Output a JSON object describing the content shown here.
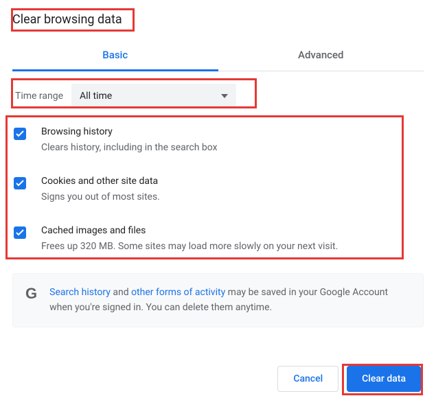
{
  "title": "Clear browsing data",
  "tabs": {
    "basic": "Basic",
    "advanced": "Advanced"
  },
  "time_range": {
    "label": "Time range",
    "value": "All time"
  },
  "options": [
    {
      "title": "Browsing history",
      "desc": "Clears history, including in the search box",
      "checked": true
    },
    {
      "title": "Cookies and other site data",
      "desc": "Signs you out of most sites.",
      "checked": true
    },
    {
      "title": "Cached images and files",
      "desc": "Frees up 320 MB. Some sites may load more slowly on your next visit.",
      "checked": true
    }
  ],
  "info": {
    "link1": "Search history",
    "mid1": " and ",
    "link2": "other forms of activity",
    "rest": " may be saved in your Google Account when you're signed in. You can delete them anytime."
  },
  "buttons": {
    "cancel": "Cancel",
    "clear": "Clear data"
  }
}
